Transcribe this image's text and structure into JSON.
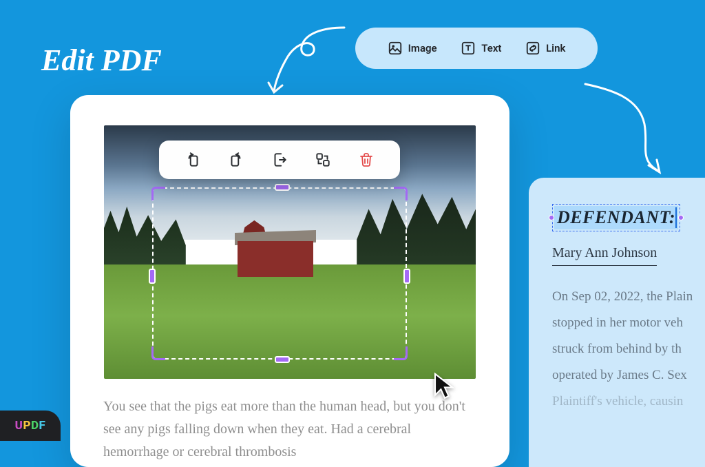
{
  "title": "Edit PDF",
  "brand": "UPDF",
  "top_toolbar": {
    "image": "Image",
    "text": "Text",
    "link": "Link"
  },
  "image_toolbar": {
    "rotate_left": "rotate-left",
    "rotate_right": "rotate-right",
    "extract": "extract",
    "replace": "replace",
    "delete": "delete"
  },
  "doc": {
    "body": "You see that the pigs eat more than the human head, but you don't see any pigs falling down when they eat. Had a cerebral hemorrhage or cerebral thrombosis"
  },
  "detail": {
    "label": "DEFENDANT:",
    "name": "Mary Ann Johnson",
    "body_l1": "On Sep 02, 2022, the Plain",
    "body_l2": "stopped in her motor veh",
    "body_l3": "struck from behind by th",
    "body_l4": "operated by James C. Sex",
    "body_l5": "Plaintiff's vehicle, causin"
  }
}
